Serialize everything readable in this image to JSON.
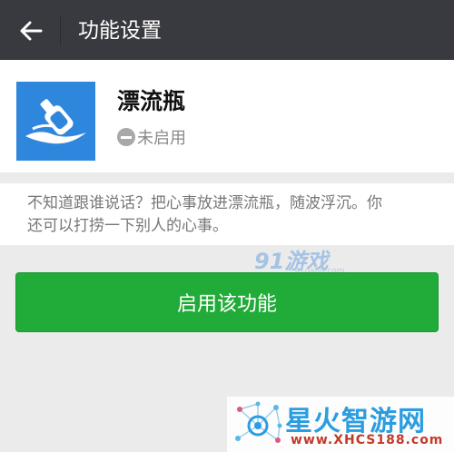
{
  "header": {
    "title": "功能设置",
    "back_icon": "arrow-left-icon"
  },
  "app": {
    "name": "漂流瓶",
    "icon": "bottle-icon",
    "status": "未启用",
    "status_icon": "minus-circle-icon"
  },
  "description": {
    "line1": "不知道跟谁说话？把心事放进漂流瓶，随波浮沉。你",
    "line2": "还可以打捞一下别人的心事。"
  },
  "actions": {
    "enable_label": "启用该功能"
  },
  "watermarks": {
    "top_brand": "91游戏",
    "top_url": "91danji.com",
    "bottom_brand": "星火智游网",
    "bottom_url": "www.XHCS188.com"
  },
  "colors": {
    "header_bg": "#393a3f",
    "accent_green": "#21ab38",
    "icon_blue": "#2f86dd"
  }
}
